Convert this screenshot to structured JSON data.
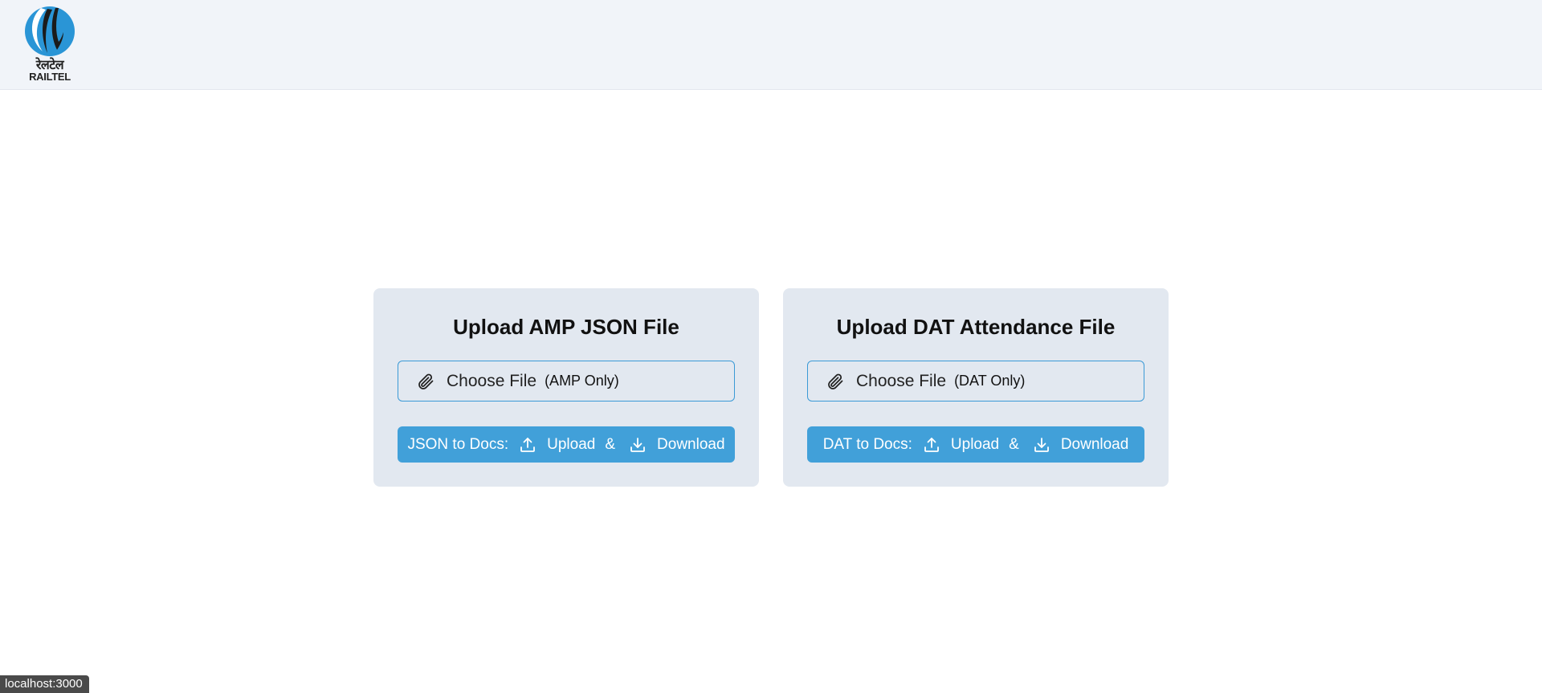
{
  "header": {
    "logo": {
      "hindi_text": "रेलटेल",
      "english_text": "RAILTEL"
    }
  },
  "cards": [
    {
      "title": "Upload AMP JSON File",
      "file_picker": {
        "label": "Choose File",
        "hint": "(AMP Only)"
      },
      "action": {
        "prefix": "JSON to Docs:",
        "upload_label": "Upload",
        "ampersand": "&",
        "download_label": "Download"
      }
    },
    {
      "title": "Upload DAT Attendance File",
      "file_picker": {
        "label": "Choose File",
        "hint": "(DAT Only)"
      },
      "action": {
        "prefix": "DAT to Docs:",
        "upload_label": "Upload",
        "ampersand": "&",
        "download_label": "Download"
      }
    }
  ],
  "status_bar": {
    "url": "localhost:3000"
  },
  "icons": {
    "clip": "paperclip-icon",
    "upload": "upload-icon",
    "download": "download-icon"
  },
  "colors": {
    "header_bg": "#f1f4f9",
    "card_bg": "#e2e8f0",
    "accent": "#41a0d9",
    "picker_border": "#3b9ad6"
  }
}
